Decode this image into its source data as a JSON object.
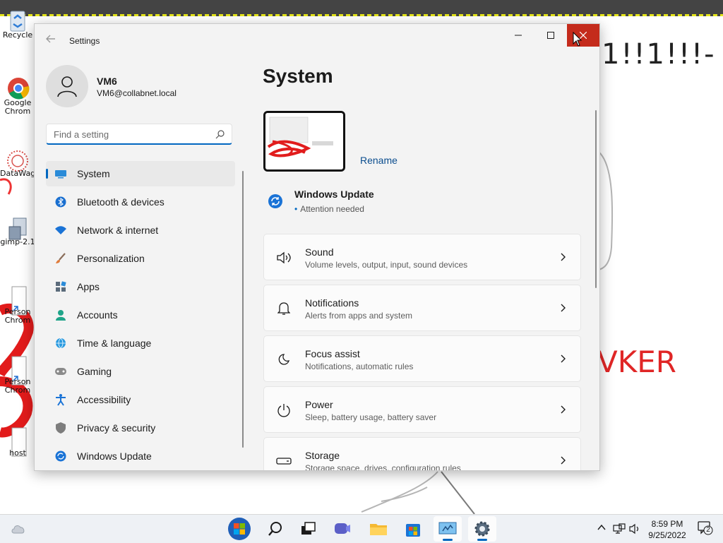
{
  "desktop": {
    "background_text_1": "1!!1!!!-",
    "background_text_2": "VKER",
    "icons": [
      {
        "label": "Recycle",
        "icon": "recycle-bin-icon"
      },
      {
        "label": "Google",
        "icon": "chrome-icon"
      },
      {
        "label": "Chrom",
        "icon": "chrome-icon"
      },
      {
        "label": "DataWag",
        "icon": "datawag-icon"
      },
      {
        "label": "gimp-2.1",
        "icon": "gimp-installer-icon"
      },
      {
        "label": "Person",
        "icon": "shortcut-icon"
      },
      {
        "label": "Chrom",
        "icon": "shortcut-icon"
      },
      {
        "label": "Person",
        "icon": "shortcut-icon"
      },
      {
        "label": "Chrom",
        "icon": "shortcut-icon"
      },
      {
        "label": "host",
        "icon": "file-icon"
      }
    ]
  },
  "window": {
    "title": "Settings",
    "controls": [
      "minimize-icon",
      "maximize-icon",
      "close-icon"
    ],
    "accent": "#0067c0",
    "close_hover": "#c42b1c"
  },
  "sidebar": {
    "user": {
      "name": "VM6",
      "email": "VM6@collabnet.local"
    },
    "search": {
      "placeholder": "Find a setting",
      "value": ""
    },
    "items": [
      {
        "label": "System",
        "icon": "system-display-icon",
        "active": true
      },
      {
        "label": "Bluetooth & devices",
        "icon": "bluetooth-icon",
        "active": false
      },
      {
        "label": "Network & internet",
        "icon": "wifi-icon",
        "active": false
      },
      {
        "label": "Personalization",
        "icon": "brush-icon",
        "active": false
      },
      {
        "label": "Apps",
        "icon": "apps-icon",
        "active": false
      },
      {
        "label": "Accounts",
        "icon": "accounts-icon",
        "active": false
      },
      {
        "label": "Time & language",
        "icon": "globe-clock-icon",
        "active": false
      },
      {
        "label": "Gaming",
        "icon": "gamepad-icon",
        "active": false
      },
      {
        "label": "Accessibility",
        "icon": "accessibility-icon",
        "active": false
      },
      {
        "label": "Privacy & security",
        "icon": "shield-icon",
        "active": false
      },
      {
        "label": "Windows Update",
        "icon": "update-icon",
        "active": false
      }
    ]
  },
  "main": {
    "title": "System",
    "rename_label": "Rename",
    "windows_update": {
      "title": "Windows Update",
      "status": "Attention needed"
    },
    "cards": [
      {
        "title": "Sound",
        "subtitle": "Volume levels, output, input, sound devices",
        "icon": "speaker-icon"
      },
      {
        "title": "Notifications",
        "subtitle": "Alerts from apps and system",
        "icon": "bell-icon"
      },
      {
        "title": "Focus assist",
        "subtitle": "Notifications, automatic rules",
        "icon": "moon-icon"
      },
      {
        "title": "Power",
        "subtitle": "Sleep, battery usage, battery saver",
        "icon": "power-icon"
      },
      {
        "title": "Storage",
        "subtitle": "Storage space, drives, configuration rules",
        "icon": "storage-icon"
      }
    ]
  },
  "taskbar": {
    "apps": [
      "start-icon",
      "search-icon",
      "task-view-icon",
      "chat-icon",
      "file-explorer-icon",
      "store-icon",
      "control-panel-icon",
      "settings-icon"
    ],
    "clock": {
      "time": "8:59 PM",
      "date": "9/25/2022"
    },
    "notification_count": "2"
  }
}
